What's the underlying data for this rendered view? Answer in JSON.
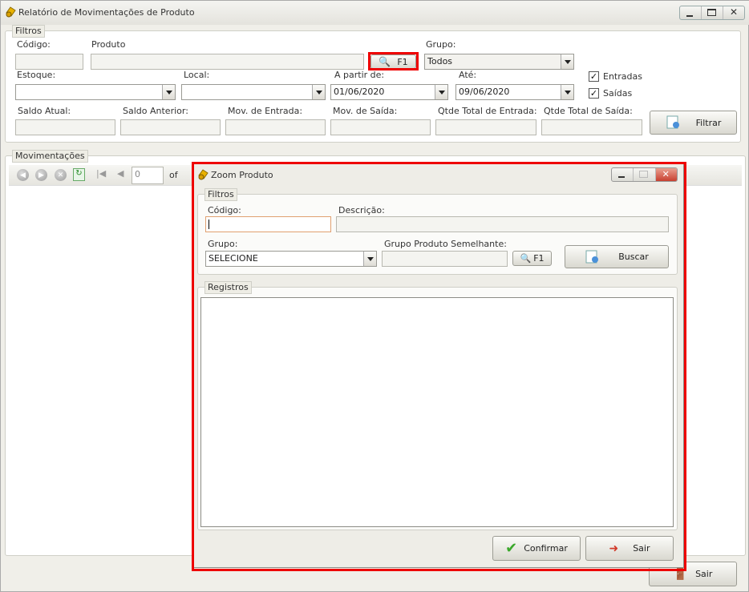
{
  "window": {
    "title": "Relatório de Movimentações de Produto"
  },
  "filters": {
    "legend": "Filtros",
    "codigo_label": "Código:",
    "codigo_value": "",
    "produto_label": "Produto",
    "produto_value": "",
    "f1_label": "F1",
    "grupo_label": "Grupo:",
    "grupo_value": "Todos",
    "estoque_label": "Estoque:",
    "estoque_value": "",
    "local_label": "Local:",
    "local_value": "",
    "apartir_label": "A partir de:",
    "apartir_value": "01/06/2020",
    "ate_label": "Até:",
    "ate_value": "09/06/2020",
    "entradas_label": "Entradas",
    "entradas_checked": "✓",
    "saidas_label": "Saídas",
    "saidas_checked": "✓",
    "saldo_atual_label": "Saldo Atual:",
    "saldo_anterior_label": "Saldo Anterior:",
    "mov_entrada_label": "Mov. de Entrada:",
    "mov_saida_label": "Mov. de Saída:",
    "qtde_entrada_label": "Qtde Total de Entrada:",
    "qtde_saida_label": "Qtde Total de Saída:",
    "filtrar_label": "Filtrar"
  },
  "movimentacoes": {
    "legend": "Movimentações",
    "page_value": "0",
    "of_label": "of"
  },
  "main_sair_label": "Sair",
  "dialog": {
    "title": "Zoom Produto",
    "filters_legend": "Filtros",
    "codigo_label": "Código:",
    "codigo_value": "",
    "descricao_label": "Descrição:",
    "descricao_value": "",
    "grupo_label": "Grupo:",
    "grupo_value": "SELECIONE",
    "grupo_semelhante_label": "Grupo Produto Semelhante:",
    "grupo_semelhante_value": "",
    "f1_label": "F1",
    "buscar_label": "Buscar",
    "registros_legend": "Registros",
    "confirmar_label": "Confirmar",
    "sair_label": "Sair"
  }
}
